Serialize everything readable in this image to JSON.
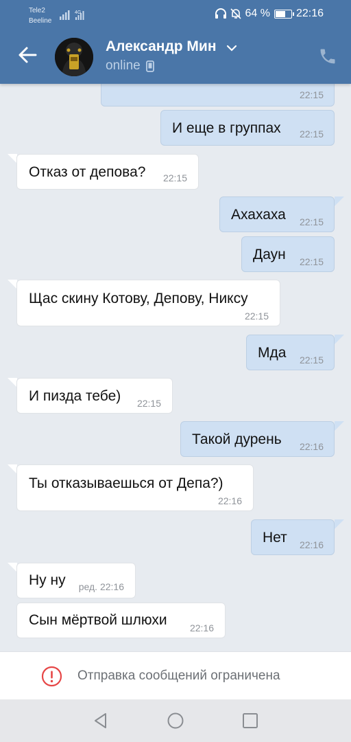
{
  "status_bar": {
    "carrier1": "Tele2",
    "carrier2": "Beeline",
    "network": "4G",
    "battery": "64 %",
    "time": "22:16"
  },
  "header": {
    "name": "Александр Мин",
    "status": "online",
    "avatar_icon": "avatar-photo",
    "back_icon": "arrow-left-icon",
    "call_icon": "phone-icon"
  },
  "messages": [
    {
      "dir": "out",
      "text": "",
      "time": "22:15"
    },
    {
      "dir": "out",
      "text": "И еще в группах",
      "time": "22:15"
    },
    {
      "dir": "in",
      "text": "Отказ от депова?",
      "time": "22:15"
    },
    {
      "dir": "out",
      "text": "Ахахаха",
      "time": "22:15"
    },
    {
      "dir": "out",
      "text": "Даун",
      "time": "22:15"
    },
    {
      "dir": "in",
      "text": "Щас скину Котову, Депову, Никсу",
      "time": "22:15"
    },
    {
      "dir": "out",
      "text": "Мда",
      "time": "22:15"
    },
    {
      "dir": "in",
      "text": "И пизда тебе)",
      "time": "22:15"
    },
    {
      "dir": "out",
      "text": "Такой дурень",
      "time": "22:16"
    },
    {
      "dir": "in",
      "text": "Ты отказываешься от Депа?)",
      "time": "22:16"
    },
    {
      "dir": "out",
      "text": "Нет",
      "time": "22:16"
    },
    {
      "dir": "in",
      "text": "Ну ну",
      "time": "ред. 22:16"
    },
    {
      "dir": "in",
      "text": "Сын мёртвой шлюхи",
      "time": "22:16"
    }
  ],
  "restriction": {
    "text": "Отправка сообщений ограничена",
    "icon": "exclamation-circle-icon",
    "color": "#e64646"
  },
  "nav": {
    "back": "triangle-back-icon",
    "home": "circle-home-icon",
    "recents": "square-recents-icon"
  },
  "colors": {
    "header_bg": "#4a76a8",
    "chat_bg": "#e7ebf0",
    "bubble_out": "#cfe0f3",
    "bubble_in": "#ffffff"
  }
}
